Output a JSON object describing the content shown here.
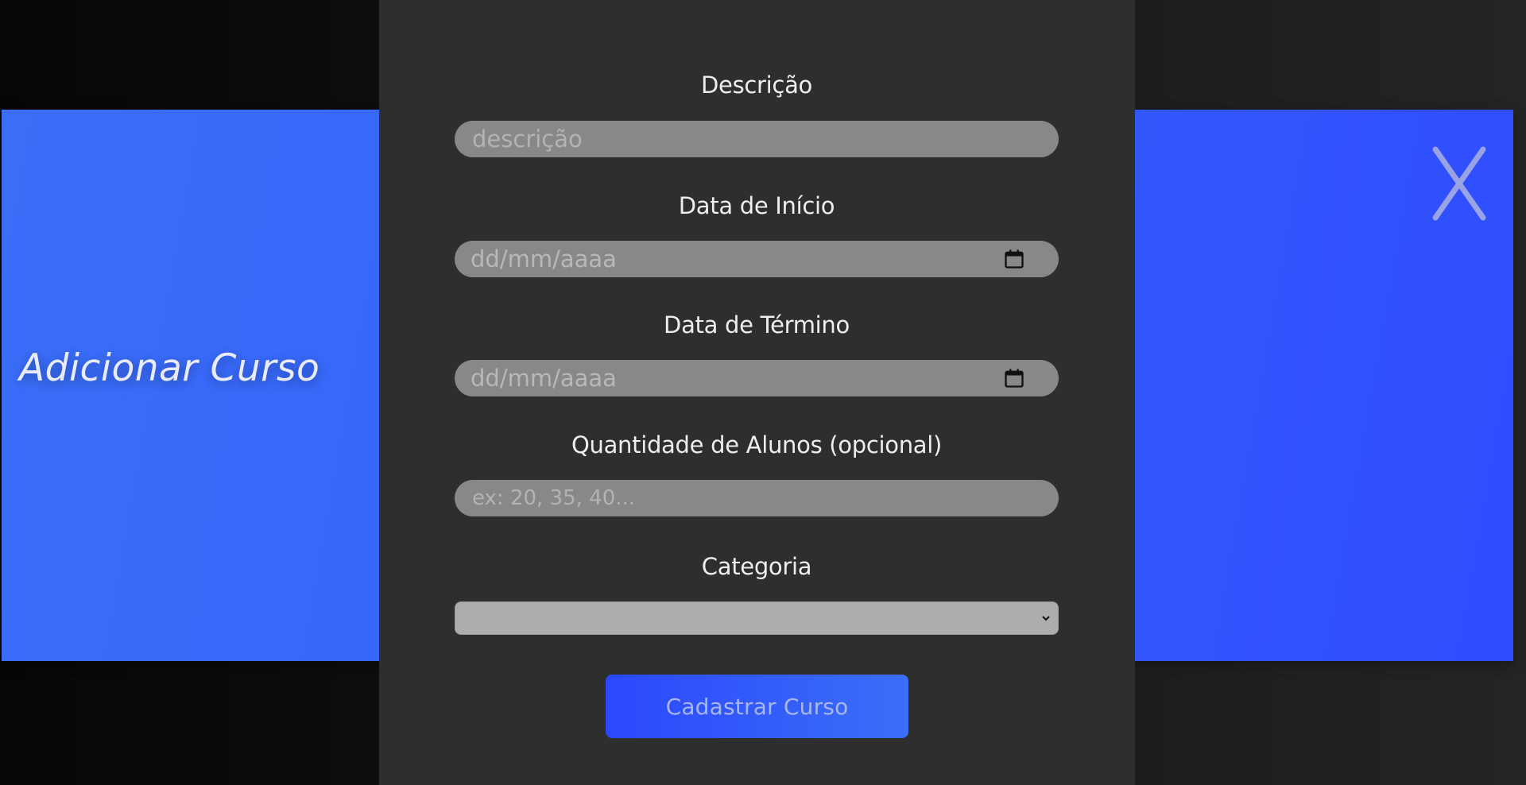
{
  "banner": {
    "title": "Adicionar Curso",
    "close_label": "X",
    "color_primary": "#3562fa"
  },
  "form": {
    "descricao": {
      "label": "Descrição",
      "placeholder": "descrição"
    },
    "data_inicio": {
      "label": "Data de Início",
      "placeholder": "dd/mm/aaaa"
    },
    "data_termino": {
      "label": "Data de Término",
      "placeholder": "dd/mm/aaaa"
    },
    "quantidade": {
      "label": "Quantidade de Alunos (opcional)",
      "placeholder": "ex: 20, 35, 40..."
    },
    "categoria": {
      "label": "Categoria",
      "selected": ""
    },
    "submit_label": "Cadastrar Curso"
  },
  "icons": {
    "calendar": "calendar-icon",
    "close": "close-icon",
    "chevron": "chevron-down-icon"
  }
}
